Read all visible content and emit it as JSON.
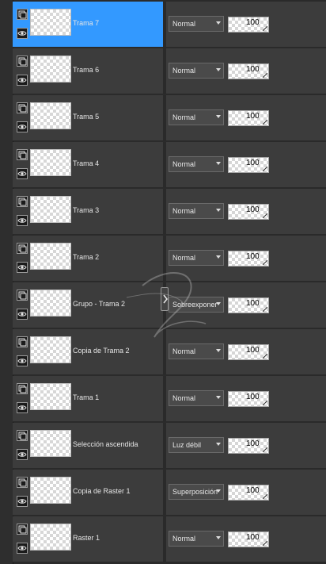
{
  "layers": [
    {
      "name": "Trama 7",
      "blend": "Normal",
      "opacity": "100",
      "selected": true
    },
    {
      "name": "Trama 6",
      "blend": "Normal",
      "opacity": "100",
      "selected": false
    },
    {
      "name": "Trama 5",
      "blend": "Normal",
      "opacity": "100",
      "selected": false
    },
    {
      "name": "Trama 4",
      "blend": "Normal",
      "opacity": "100",
      "selected": false
    },
    {
      "name": "Trama 3",
      "blend": "Normal",
      "opacity": "100",
      "selected": false
    },
    {
      "name": "Trama 2",
      "blend": "Normal",
      "opacity": "100",
      "selected": false
    },
    {
      "name": "Grupo - Trama 2",
      "blend": "Sobreexponer",
      "opacity": "100",
      "selected": false
    },
    {
      "name": "Copia de Trama 2",
      "blend": "Normal",
      "opacity": "100",
      "selected": false
    },
    {
      "name": "Trama 1",
      "blend": "Normal",
      "opacity": "100",
      "selected": false
    },
    {
      "name": "Selección ascendida",
      "blend": "Luz débil",
      "opacity": "100",
      "selected": false
    },
    {
      "name": "Copia de Raster 1",
      "blend": "Superposición",
      "opacity": "100",
      "selected": false
    },
    {
      "name": "Raster 1",
      "blend": "Normal",
      "opacity": "100",
      "selected": false
    }
  ],
  "colors": {
    "selected": "#3399ff",
    "row_bg": "#3c3c3c",
    "panel_bg": "#2a2a2a"
  },
  "icons": {
    "layer": "layer-icon",
    "visibility": "eye-icon",
    "collapse": "collapse-arrow-icon"
  }
}
